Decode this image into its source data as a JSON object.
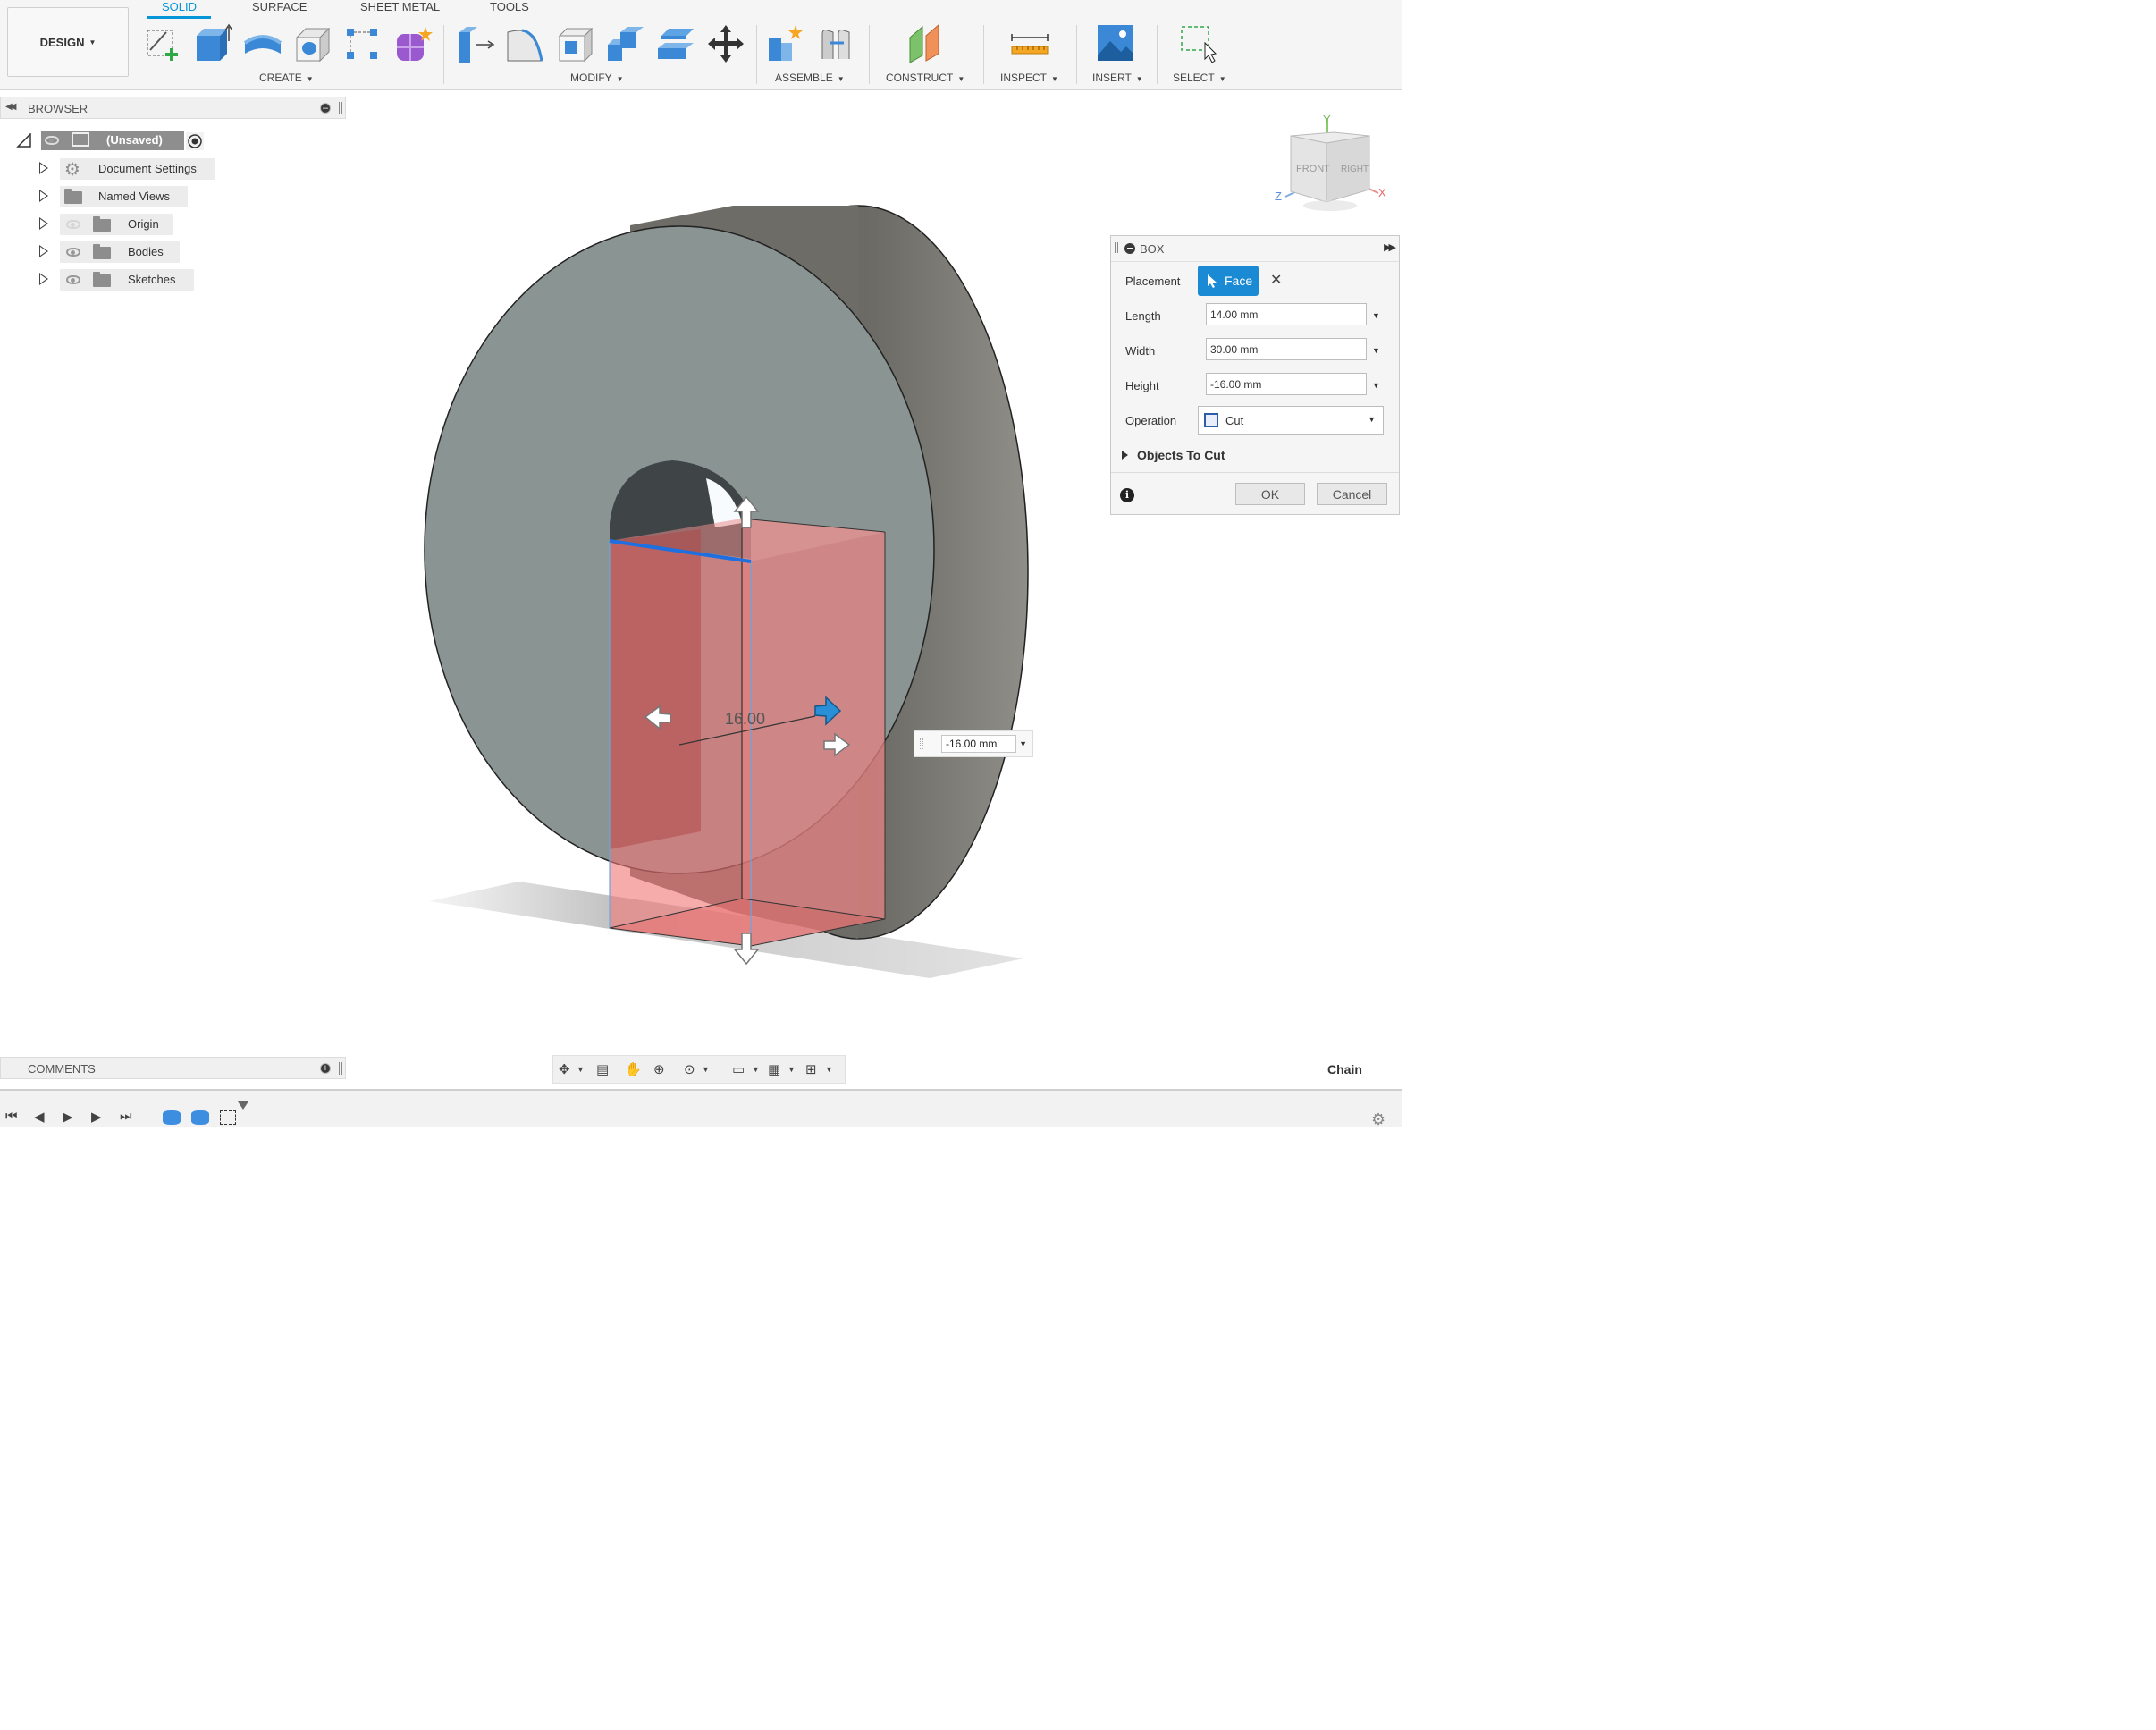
{
  "toolbar": {
    "workspace": "DESIGN",
    "tabs": [
      "SOLID",
      "SURFACE",
      "SHEET METAL",
      "TOOLS"
    ],
    "groups": {
      "create": "CREATE",
      "modify": "MODIFY",
      "assemble": "ASSEMBLE",
      "construct": "CONSTRUCT",
      "inspect": "INSPECT",
      "insert": "INSERT",
      "select": "SELECT"
    },
    "icons": {
      "create": [
        "create-sketch-icon",
        "extrude-icon",
        "revolve-icon",
        "hole-icon",
        "pattern-icon",
        "create-form-icon"
      ],
      "modify": [
        "press-pull-icon",
        "fillet-icon",
        "shell-icon",
        "combine-icon",
        "offset-face-icon",
        "move-icon"
      ],
      "assemble": [
        "new-component-icon",
        "joint-icon"
      ],
      "construct": [
        "offset-plane-icon"
      ],
      "inspect": [
        "measure-icon"
      ],
      "insert": [
        "insert-image-icon"
      ],
      "select": [
        "window-select-icon"
      ]
    }
  },
  "browser": {
    "title": "BROWSER",
    "root": "(Unsaved)",
    "items": [
      {
        "label": "Document Settings",
        "icon": "gear-icon",
        "visible": null
      },
      {
        "label": "Named Views",
        "icon": "folder-icon",
        "visible": null
      },
      {
        "label": "Origin",
        "icon": "folder-icon",
        "visible": false
      },
      {
        "label": "Bodies",
        "icon": "folder-icon",
        "visible": true
      },
      {
        "label": "Sketches",
        "icon": "folder-icon",
        "visible": true
      }
    ]
  },
  "viewport": {
    "dimension_label": "16.00",
    "hud_value": "-16.00 mm",
    "viewcube": {
      "front": "FRONT",
      "right": "RIGHT",
      "x": "X",
      "y": "Y",
      "z": "Z"
    }
  },
  "dialog": {
    "title": "BOX",
    "placement_label": "Placement",
    "placement_value": "Face",
    "length_label": "Length",
    "length_value": "14.00 mm",
    "width_label": "Width",
    "width_value": "30.00 mm",
    "height_label": "Height",
    "height_value": "-16.00 mm",
    "operation_label": "Operation",
    "operation_value": "Cut",
    "objects_to_cut": "Objects To Cut",
    "ok": "OK",
    "cancel": "Cancel"
  },
  "comments": {
    "title": "COMMENTS"
  },
  "status": {
    "chain": "Chain"
  },
  "colors": {
    "accent": "#0696d7",
    "body_face": "#8a9493",
    "body_side": "#6e6e69",
    "cut_preview": "#f07a7a",
    "selected_edge": "#1e6fe0"
  }
}
